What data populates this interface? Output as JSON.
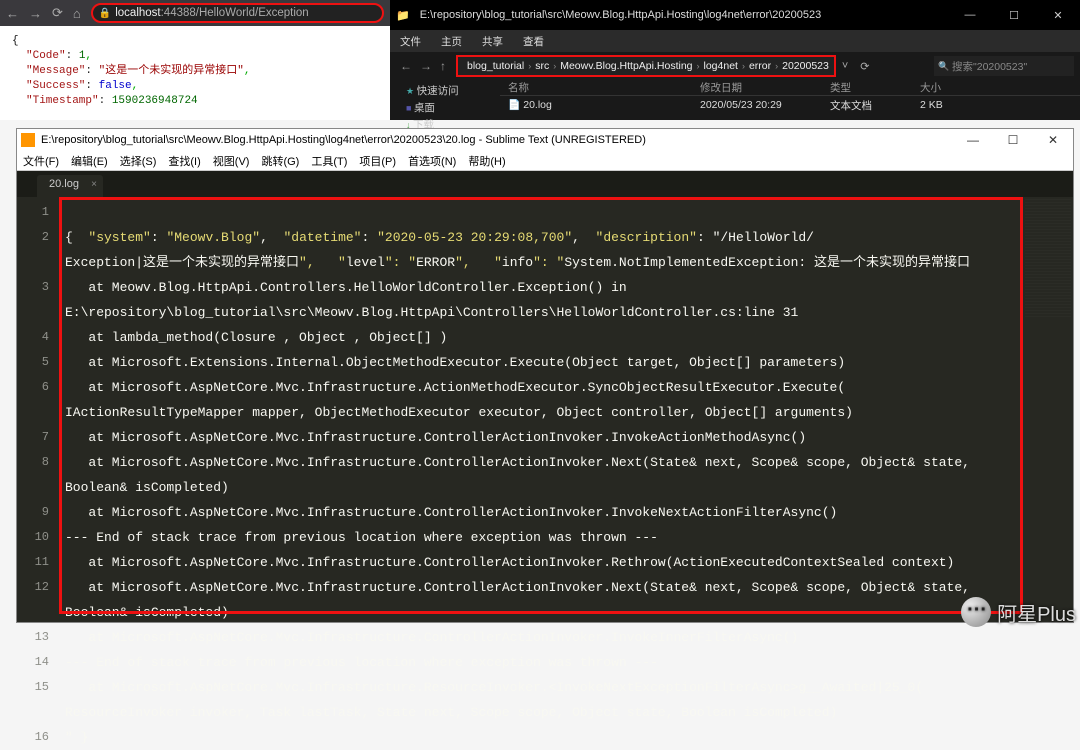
{
  "browser": {
    "address_host": "localhost",
    "address_rest": ":44388/HelloWorld/Exception",
    "json": {
      "code_key": "\"Code\"",
      "code_val": "1",
      "message_key": "\"Message\"",
      "message_val": "\"这是一个未实现的异常接口\"",
      "success_key": "\"Success\"",
      "success_val": "false",
      "timestamp_key": "\"Timestamp\"",
      "timestamp_val": "1590236948724"
    }
  },
  "explorer": {
    "title": "E:\\repository\\blog_tutorial\\src\\Meowv.Blog.HttpApi.Hosting\\log4net\\error\\20200523",
    "menu": [
      "文件",
      "主页",
      "共享",
      "查看"
    ],
    "crumbs": [
      "blog_tutorial",
      "src",
      "Meowv.Blog.HttpApi.Hosting",
      "log4net",
      "error",
      "20200523"
    ],
    "search_placeholder": "搜索\"20200523\"",
    "sidebar": {
      "quick": "快速访问",
      "desktop": "桌面",
      "downloads": "下载"
    },
    "cols": {
      "name": "名称",
      "date": "修改日期",
      "type": "类型",
      "size": "大小"
    },
    "files": [
      {
        "name": "20.log",
        "date": "2020/05/23 20:29",
        "type": "文本文档",
        "size": "2 KB"
      }
    ]
  },
  "sublime": {
    "title": "E:\\repository\\blog_tutorial\\src\\Meowv.Blog.HttpApi.Hosting\\log4net\\error\\20200523\\20.log - Sublime Text (UNREGISTERED)",
    "menu": [
      "文件(F)",
      "编辑(E)",
      "选择(S)",
      "查找(I)",
      "视图(V)",
      "跳转(G)",
      "工具(T)",
      "项目(P)",
      "首选项(N)",
      "帮助(H)"
    ],
    "tab": "20.log",
    "gutter": [
      "1",
      "2",
      "",
      "3",
      "",
      "4",
      "5",
      "6",
      "",
      "7",
      "8",
      "",
      "9",
      "10",
      "11",
      "12",
      "",
      "13",
      "14",
      "15",
      "",
      "16"
    ],
    "lines": [
      "",
      "{  \"system\": \"Meowv.Blog\",  \"datetime\": \"2020-05-23 20:29:08,700\",  \"description\": \"/HelloWorld/",
      "Exception|这是一个未实现的异常接口\",   \"level\": \"ERROR\",   \"info\": \"System.NotImplementedException: 这是一个未实现的异常接口",
      "   at Meowv.Blog.HttpApi.Controllers.HelloWorldController.Exception() in ",
      "E:\\repository\\blog_tutorial\\src\\Meowv.Blog.HttpApi\\Controllers\\HelloWorldController.cs:line 31",
      "   at lambda_method(Closure , Object , Object[] )",
      "   at Microsoft.Extensions.Internal.ObjectMethodExecutor.Execute(Object target, Object[] parameters)",
      "   at Microsoft.AspNetCore.Mvc.Infrastructure.ActionMethodExecutor.SyncObjectResultExecutor.Execute(",
      "IActionResultTypeMapper mapper, ObjectMethodExecutor executor, Object controller, Object[] arguments)",
      "   at Microsoft.AspNetCore.Mvc.Infrastructure.ControllerActionInvoker.InvokeActionMethodAsync()",
      "   at Microsoft.AspNetCore.Mvc.Infrastructure.ControllerActionInvoker.Next(State& next, Scope& scope, Object& state, ",
      "Boolean& isCompleted)",
      "   at Microsoft.AspNetCore.Mvc.Infrastructure.ControllerActionInvoker.InvokeNextActionFilterAsync()",
      "--- End of stack trace from previous location where exception was thrown ---",
      "   at Microsoft.AspNetCore.Mvc.Infrastructure.ControllerActionInvoker.Rethrow(ActionExecutedContextSealed context)",
      "   at Microsoft.AspNetCore.Mvc.Infrastructure.ControllerActionInvoker.Next(State& next, Scope& scope, Object& state, ",
      "Boolean& isCompleted)",
      "   at Microsoft.AspNetCore.Mvc.Infrastructure.ControllerActionInvoker.InvokeInnerFilterAsync()",
      "--- End of stack trace from previous location where exception was thrown ---",
      "   at Microsoft.AspNetCore.Mvc.Infrastructure.ResourceInvoker.<InvokeNextExceptionFilterAsync>g__Awaited|25_0(",
      "ResourceInvoker invoker, Task lastTask, State next, Scope scope, Object state, Boolean isCompleted)",
      "\" }"
    ]
  },
  "watermark": "阿星Plus"
}
